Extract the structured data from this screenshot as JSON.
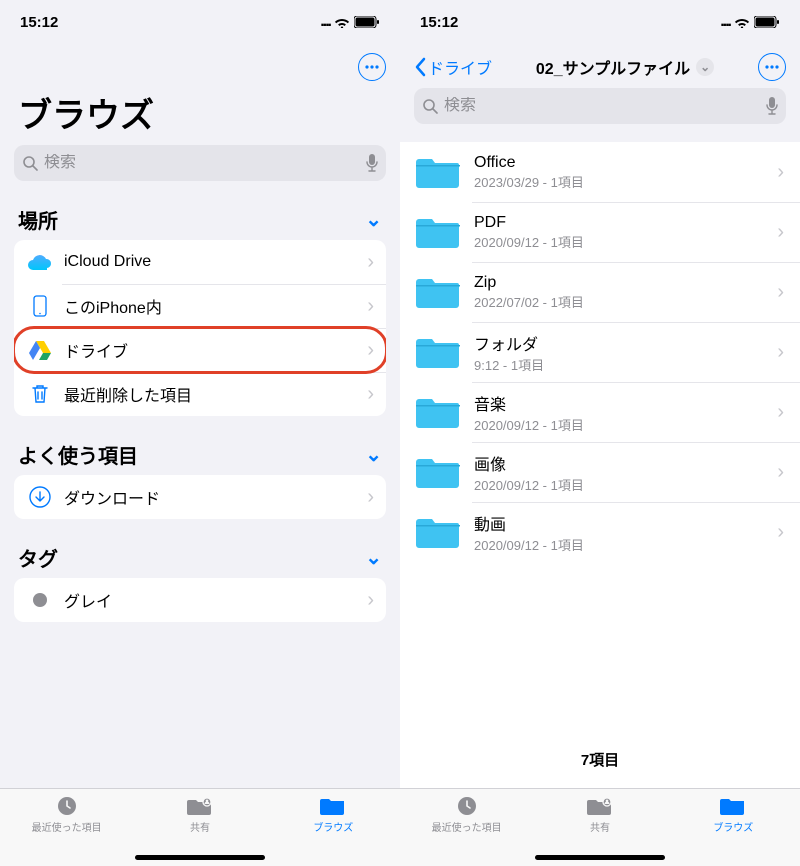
{
  "status": {
    "time": "15:12"
  },
  "left": {
    "title": "ブラウズ",
    "search_placeholder": "検索",
    "sections": {
      "locations": {
        "header": "場所",
        "items": [
          {
            "label": "iCloud Drive",
            "icon": "icloud"
          },
          {
            "label": "このiPhone内",
            "icon": "iphone"
          },
          {
            "label": "ドライブ",
            "icon": "gdrive",
            "highlighted": true
          },
          {
            "label": "最近削除した項目",
            "icon": "trash"
          }
        ]
      },
      "favorites": {
        "header": "よく使う項目",
        "items": [
          {
            "label": "ダウンロード",
            "icon": "download"
          }
        ]
      },
      "tags": {
        "header": "タグ",
        "items": [
          {
            "label": "グレイ",
            "icon": "gray-dot"
          }
        ]
      }
    }
  },
  "right": {
    "back_label": "ドライブ",
    "folder_title": "02_サンプルファイル",
    "search_placeholder": "検索",
    "folders": [
      {
        "name": "Office",
        "meta": "2023/03/29 - 1項目"
      },
      {
        "name": "PDF",
        "meta": "2020/09/12 - 1項目"
      },
      {
        "name": "Zip",
        "meta": "2022/07/02 - 1項目"
      },
      {
        "name": "フォルダ",
        "meta": "9:12 - 1項目"
      },
      {
        "name": "音楽",
        "meta": "2020/09/12 - 1項目"
      },
      {
        "name": "画像",
        "meta": "2020/09/12 - 1項目"
      },
      {
        "name": "動画",
        "meta": "2020/09/12 - 1項目"
      }
    ],
    "count_label": "7項目"
  },
  "tabs": [
    {
      "label": "最近使った項目",
      "icon": "clock"
    },
    {
      "label": "共有",
      "icon": "shared"
    },
    {
      "label": "ブラウズ",
      "icon": "folder",
      "active": true
    }
  ]
}
